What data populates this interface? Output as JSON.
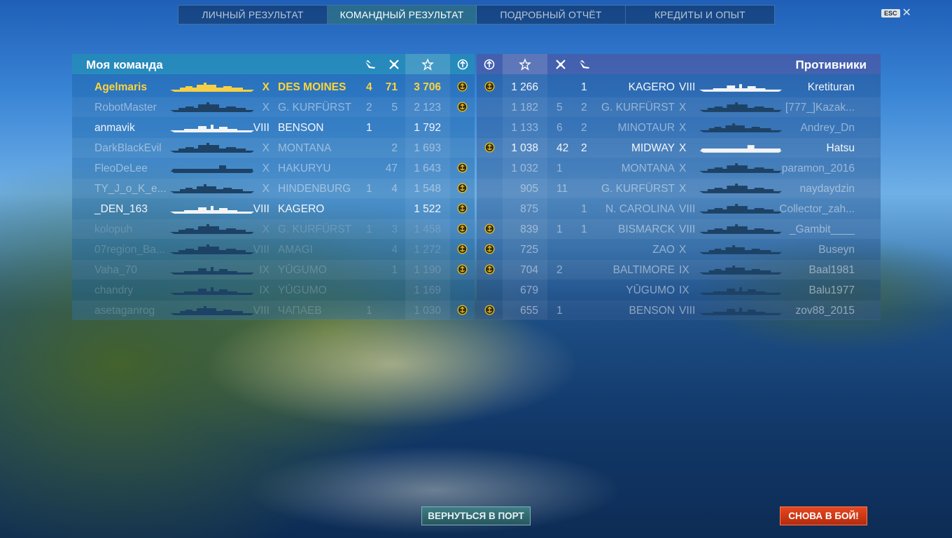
{
  "tabs": [
    {
      "label": "ЛИЧНЫЙ РЕЗУЛЬТАТ",
      "active": false
    },
    {
      "label": "КОМАНДНЫЙ РЕЗУЛЬТАТ",
      "active": true
    },
    {
      "label": "ПОДРОБНЫЙ ОТЧЁТ",
      "active": false
    },
    {
      "label": "КРЕДИТЫ И ОПЫТ",
      "active": false
    }
  ],
  "esc": {
    "key": "ESC",
    "close": "✕"
  },
  "my_team": {
    "title": "Моя команда",
    "header_icons": [
      "plane-icon",
      "kill-icon",
      "star-icon",
      "medal-icon"
    ],
    "rows": [
      {
        "player": "Agelmaris",
        "tier": "X",
        "ship": "DES MOINES",
        "planes": "4",
        "kills": "71",
        "xp": "3 706",
        "medal": true,
        "style": "gold",
        "ship_kind": "cruiser"
      },
      {
        "player": "RobotMaster",
        "tier": "X",
        "ship": "G. KURFÜRST",
        "planes": "2",
        "kills": "5",
        "xp": "2 123",
        "medal": true,
        "style": "dim",
        "ship_kind": "battleship"
      },
      {
        "player": "anmavik",
        "tier": "VIII",
        "ship": "BENSON",
        "planes": "1",
        "kills": "",
        "xp": "1 792",
        "medal": false,
        "style": "bright",
        "ship_kind": "destroyer"
      },
      {
        "player": "DarkBlackEvil",
        "tier": "X",
        "ship": "MONTANA",
        "planes": "",
        "kills": "2",
        "xp": "1 693",
        "medal": false,
        "style": "dim",
        "ship_kind": "battleship"
      },
      {
        "player": "FleoDeLee",
        "tier": "X",
        "ship": "HAKURYU",
        "planes": "",
        "kills": "47",
        "xp": "1 643",
        "medal": true,
        "style": "dim",
        "ship_kind": "carrier"
      },
      {
        "player": "TY_J_o_K_e...",
        "tier": "X",
        "ship": "HINDENBURG",
        "planes": "1",
        "kills": "4",
        "xp": "1 548",
        "medal": true,
        "style": "dim",
        "ship_kind": "cruiser"
      },
      {
        "player": "_DEN_163",
        "tier": "VIII",
        "ship": "KAGERO",
        "planes": "",
        "kills": "",
        "xp": "1 522",
        "medal": true,
        "style": "bright",
        "ship_kind": "destroyer"
      },
      {
        "player": "kolopuh",
        "tier": "X",
        "ship": "G. KURFÜRST",
        "planes": "1",
        "kills": "3",
        "xp": "1 458",
        "medal": true,
        "style": "dim2",
        "ship_kind": "battleship"
      },
      {
        "player": "07region_Ba...",
        "tier": "VIII",
        "ship": "AMAGI",
        "planes": "",
        "kills": "4",
        "xp": "1 272",
        "medal": true,
        "style": "dim2",
        "ship_kind": "battleship"
      },
      {
        "player": "Vaha_70",
        "tier": "IX",
        "ship": "YŪGUMO",
        "planes": "",
        "kills": "1",
        "xp": "1 190",
        "medal": true,
        "style": "dim2",
        "ship_kind": "destroyer"
      },
      {
        "player": "chandry",
        "tier": "IX",
        "ship": "YŪGUMO",
        "planes": "",
        "kills": "",
        "xp": "1 169",
        "medal": false,
        "style": "dim2",
        "ship_kind": "destroyer"
      },
      {
        "player": "asetaganrog",
        "tier": "VIII",
        "ship": "ЧАПАЕВ",
        "planes": "1",
        "kills": "",
        "xp": "1 030",
        "medal": true,
        "style": "dim2",
        "ship_kind": "cruiser"
      }
    ]
  },
  "enemy_team": {
    "title": "Противники",
    "header_icons": [
      "medal-icon",
      "star-icon",
      "kill-icon",
      "plane-icon"
    ],
    "rows": [
      {
        "player": "Kretituran",
        "tier": "VIII",
        "ship": "KAGERO",
        "planes": "1",
        "kills": "",
        "xp": "1 266",
        "medal": true,
        "style": "bright",
        "ship_kind": "destroyer"
      },
      {
        "player": "[777_]Kazak...",
        "tier": "X",
        "ship": "G. KURFÜRST",
        "planes": "2",
        "kills": "5",
        "xp": "1 182",
        "medal": false,
        "style": "dim",
        "ship_kind": "battleship"
      },
      {
        "player": "Andrey_Dn",
        "tier": "X",
        "ship": "MINOTAUR",
        "planes": "2",
        "kills": "6",
        "xp": "1 133",
        "medal": false,
        "style": "dim",
        "ship_kind": "cruiser"
      },
      {
        "player": "Hatsu",
        "tier": "X",
        "ship": "MIDWAY",
        "planes": "2",
        "kills": "42",
        "xp": "1 038",
        "medal": true,
        "style": "bright",
        "ship_kind": "carrier"
      },
      {
        "player": "paramon_2016",
        "tier": "X",
        "ship": "MONTANA",
        "planes": "",
        "kills": "1",
        "xp": "1 032",
        "medal": false,
        "style": "dim",
        "ship_kind": "battleship"
      },
      {
        "player": "naydaydzin",
        "tier": "X",
        "ship": "G. KURFÜRST",
        "planes": "",
        "kills": "11",
        "xp": "905",
        "medal": false,
        "style": "dim",
        "ship_kind": "battleship"
      },
      {
        "player": "Collector_zah...",
        "tier": "VIII",
        "ship": "N. CAROLINA",
        "planes": "1",
        "kills": "",
        "xp": "875",
        "medal": false,
        "style": "dim",
        "ship_kind": "battleship"
      },
      {
        "player": "_Gambit____",
        "tier": "VIII",
        "ship": "BISMARCK",
        "planes": "1",
        "kills": "1",
        "xp": "839",
        "medal": true,
        "style": "dim",
        "ship_kind": "battleship"
      },
      {
        "player": "Buseyn",
        "tier": "X",
        "ship": "ZAO",
        "planes": "",
        "kills": "",
        "xp": "725",
        "medal": true,
        "style": "dim",
        "ship_kind": "cruiser"
      },
      {
        "player": "Baal1981",
        "tier": "IX",
        "ship": "BALTIMORE",
        "planes": "",
        "kills": "2",
        "xp": "704",
        "medal": true,
        "style": "dim",
        "ship_kind": "cruiser"
      },
      {
        "player": "Balu1977",
        "tier": "IX",
        "ship": "YŪGUMO",
        "planes": "",
        "kills": "",
        "xp": "679",
        "medal": false,
        "style": "dim",
        "ship_kind": "destroyer"
      },
      {
        "player": "zov88_2015",
        "tier": "VIII",
        "ship": "BENSON",
        "planes": "",
        "kills": "1",
        "xp": "655",
        "medal": true,
        "style": "dim",
        "ship_kind": "destroyer"
      }
    ]
  },
  "buttons": {
    "port": "ВЕРНУТЬСЯ В ПОРТ",
    "again": "СНОВА В БОЙ!"
  },
  "colors": {
    "gold": "#ffd43b",
    "ship_gold": "#f5d046",
    "ship_white": "#f2f4f6",
    "ship_dark": "#1d4266",
    "btn_red": "#d63c16",
    "btn_teal": "#336c74"
  }
}
